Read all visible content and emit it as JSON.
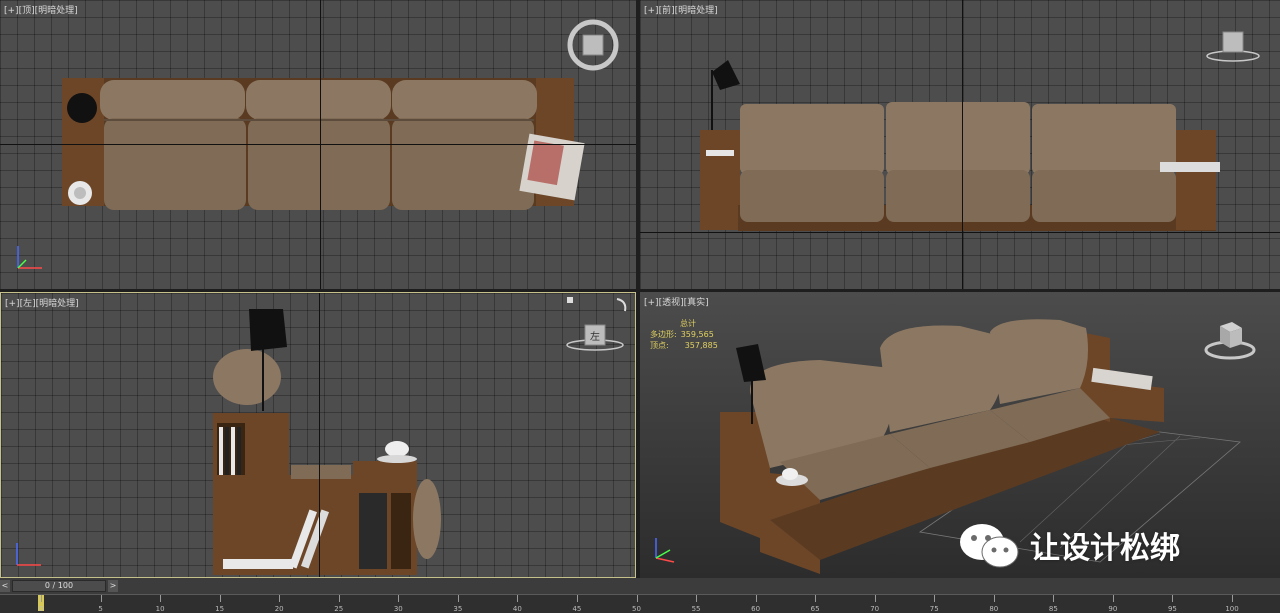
{
  "viewports": {
    "top": {
      "label": "[+][顶][明暗处理]"
    },
    "front": {
      "label": "[+][前][明暗处理]"
    },
    "left": {
      "label": "[+][左][明暗处理]"
    },
    "perspective": {
      "label": "[+][透视][真实]",
      "stats": {
        "header": "总计",
        "polys_label": "多边形:",
        "polys_value": "359,565",
        "verts_label": "顶点:",
        "verts_value": "357,885"
      }
    }
  },
  "gizmo_left_face": "左",
  "timeline": {
    "frame_display": "0 / 100",
    "prev": "<",
    "next": ">",
    "ticks": [
      "0",
      "5",
      "10",
      "15",
      "20",
      "25",
      "30",
      "35",
      "40",
      "45",
      "50",
      "55",
      "60",
      "65",
      "70",
      "75",
      "80",
      "85",
      "90",
      "95",
      "100"
    ]
  },
  "watermark": {
    "text": "让设计松绑",
    "icon": "wechat-icon"
  },
  "colors": {
    "viewport_bg": "#4d4d4d",
    "active_border": "#c6c08a",
    "stats_text": "#e0d060"
  }
}
